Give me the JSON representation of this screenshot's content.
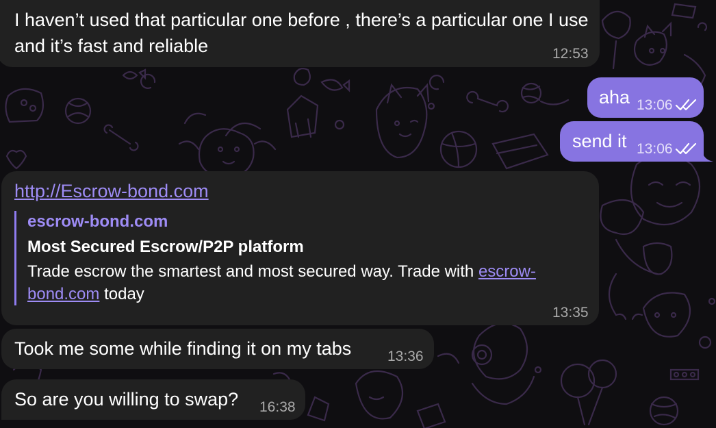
{
  "messages": [
    {
      "text": "I haven’t used that particular one before , there’s a particular one I use and it’s fast and reliable",
      "time": "12:53"
    },
    {
      "text": "aha",
      "time": "13:06"
    },
    {
      "text": "send it",
      "time": "13:06"
    },
    {
      "link": "http://Escrow-bond.com",
      "preview": {
        "site": "escrow-bond.com",
        "title": "Most Secured Escrow/P2P platform",
        "description_before": "Trade escrow the smartest and most secured way. Trade with ",
        "description_link": "escrow-bond.com",
        "description_after": " today"
      },
      "time": "13:35"
    },
    {
      "text": "Took me some while finding it on my tabs",
      "time": "13:36"
    },
    {
      "text": "So are you willing to swap?",
      "time": "16:38"
    }
  ],
  "icons": {
    "read_receipt": "double-check-icon"
  },
  "colors": {
    "incoming_bubble": "#212121",
    "outgoing_bubble": "#8774e1",
    "link": "#9e8cf5",
    "background": "#0f0e11"
  }
}
